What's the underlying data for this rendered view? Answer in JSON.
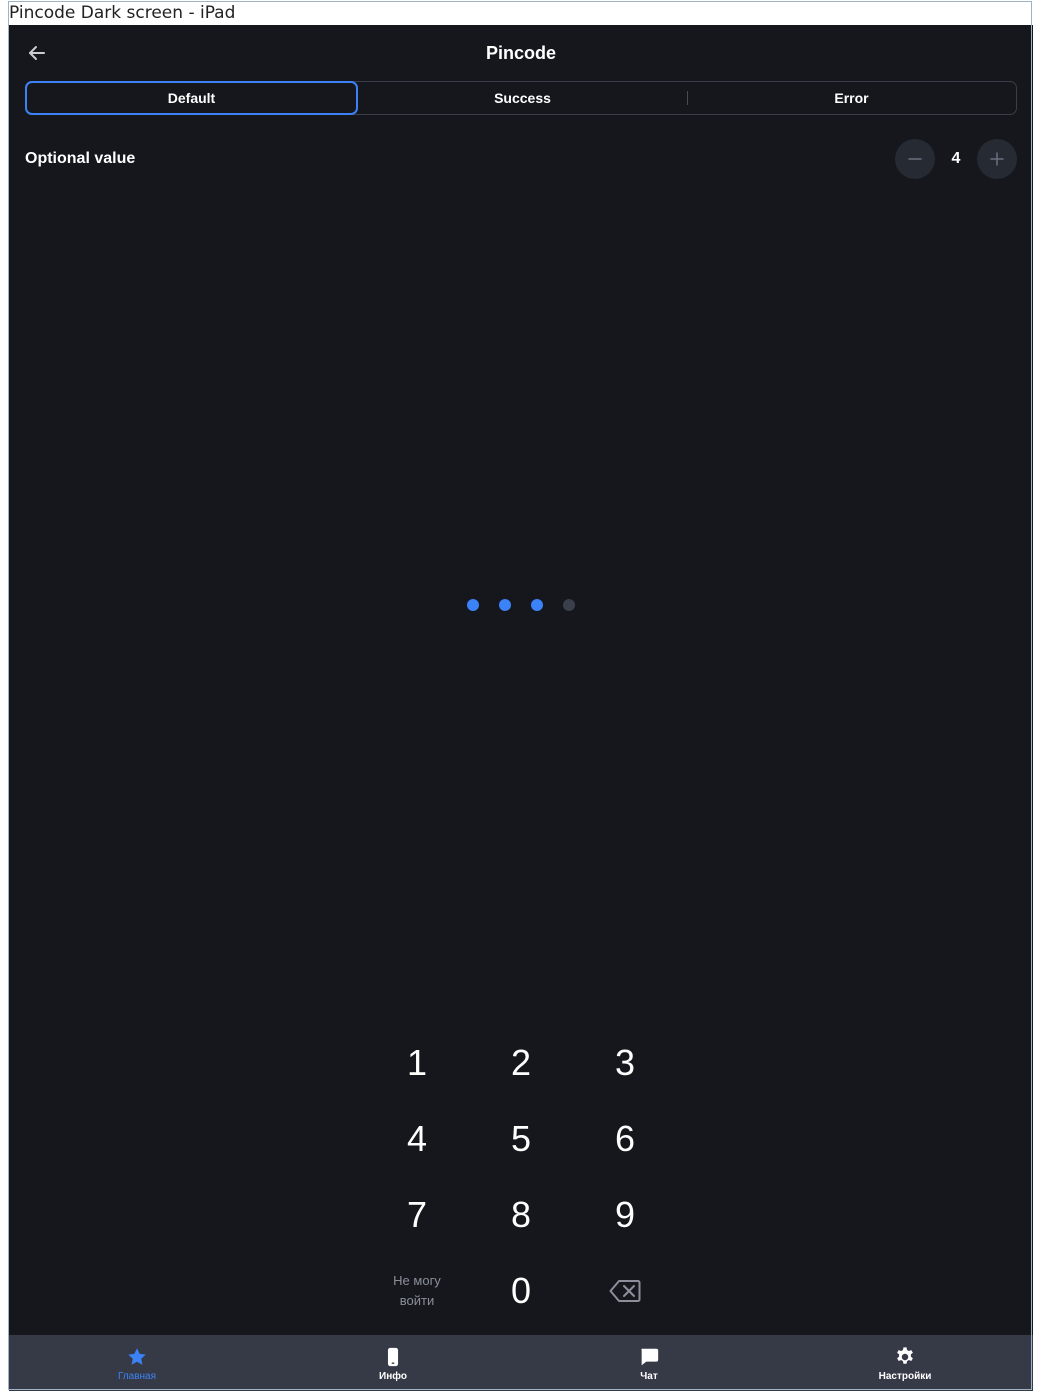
{
  "window": {
    "title": "Pincode Dark screen - iPad"
  },
  "header": {
    "title": "Pincode",
    "back_icon": "arrow-left-icon"
  },
  "segments": [
    {
      "label": "Default",
      "active": true
    },
    {
      "label": "Success",
      "active": false
    },
    {
      "label": "Error",
      "active": false
    }
  ],
  "optional": {
    "label": "Optional value",
    "value": "4",
    "minus_icon": "minus-icon",
    "plus_icon": "plus-icon"
  },
  "pin": {
    "length": 4,
    "filled": 3
  },
  "keypad": {
    "keys": [
      "1",
      "2",
      "3",
      "4",
      "5",
      "6",
      "7",
      "8",
      "9"
    ],
    "cant_login_line1": "Не могу",
    "cant_login_line2": "войти",
    "zero": "0",
    "backspace_icon": "backspace-icon"
  },
  "nav": {
    "items": [
      {
        "label": "Главная",
        "icon": "star-icon",
        "active": true
      },
      {
        "label": "Инфо",
        "icon": "phone-icon",
        "active": false
      },
      {
        "label": "Чат",
        "icon": "chat-icon",
        "active": false
      },
      {
        "label": "Настройки",
        "icon": "gear-icon",
        "active": false
      }
    ]
  },
  "colors": {
    "background": "#15171d",
    "accent": "#3b82f6",
    "nav_background": "#363a47",
    "dot_empty": "#3a3f4b",
    "muted_text": "#8a8f99"
  }
}
